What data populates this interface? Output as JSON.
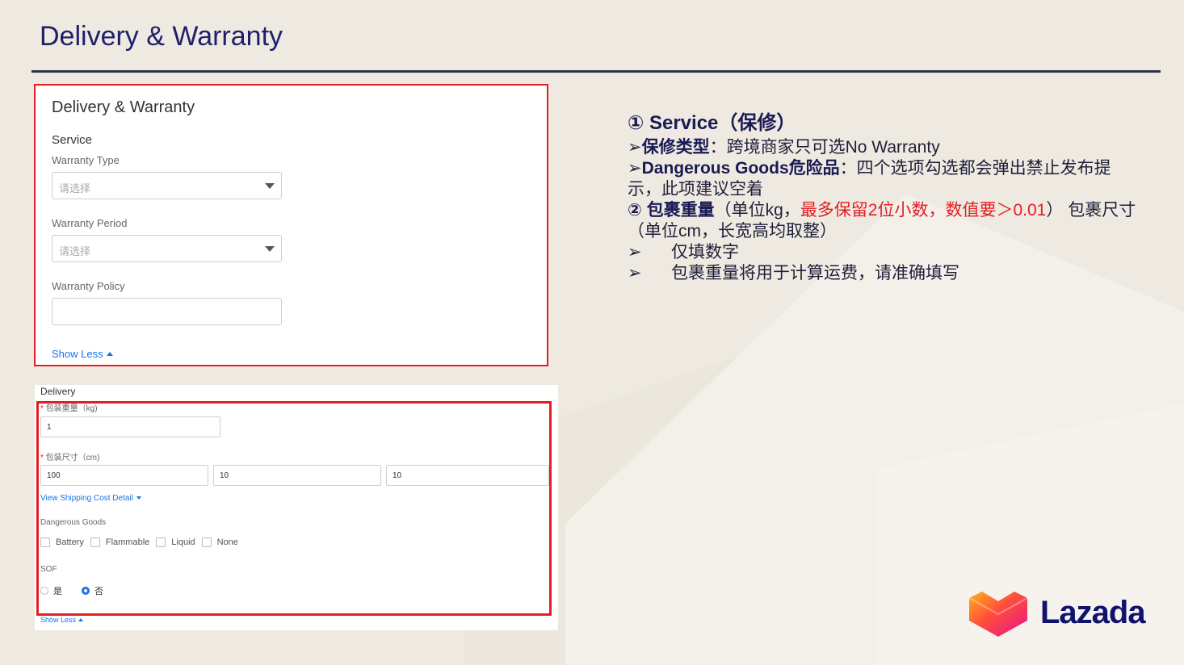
{
  "slide": {
    "title": "Delivery & Warranty"
  },
  "panel1": {
    "heading": "Delivery & Warranty",
    "section": "Service",
    "warranty_type": {
      "label": "Warranty Type",
      "placeholder": "请选择"
    },
    "warranty_period": {
      "label": "Warranty Period",
      "placeholder": "请选择"
    },
    "warranty_policy": {
      "label": "Warranty Policy",
      "value": ""
    },
    "show_less": "Show Less"
  },
  "panel2": {
    "heading": "Delivery",
    "weight": {
      "label": "包装重量（kg)",
      "value": "1"
    },
    "size": {
      "label": "包装尺寸（cm)",
      "length": "100",
      "width": "10",
      "height": "10"
    },
    "shipping_link": "View Shipping Cost Detail",
    "dangerous_goods": {
      "label": "Dangerous Goods",
      "options": [
        "Battery",
        "Flammable",
        "Liquid",
        "None"
      ]
    },
    "sof": {
      "label": "SOF",
      "options": [
        "是",
        "否"
      ],
      "selected": "否"
    },
    "show_less": "Show Less"
  },
  "notes": {
    "h1_num": "①",
    "h1": "Service（保修）",
    "b1_bold": "保修类型",
    "b1_text": "：跨境商家只可选No Warranty",
    "b2_bold": "Dangerous Goods危险品",
    "b2_text": "：四个选项勾选都会弹出禁止发布提示，此项建议空着",
    "h2_num": "②",
    "h2": "包裹重量",
    "h2_text1": "（单位kg，",
    "h2_red": "最多保留2位小数，数值要＞0.01",
    "h2_text2": "） 包裹尺寸（单位cm，长宽高均取整）",
    "sub1": "仅填数字",
    "sub2": "包裹重量将用于计算运费，请准确填写",
    "arrow": "➢"
  },
  "logo": {
    "text": "Lazada"
  },
  "colors": {
    "accent_red": "#e31e24",
    "link_blue": "#1a73e8",
    "title_navy": "#1f1f6b"
  }
}
